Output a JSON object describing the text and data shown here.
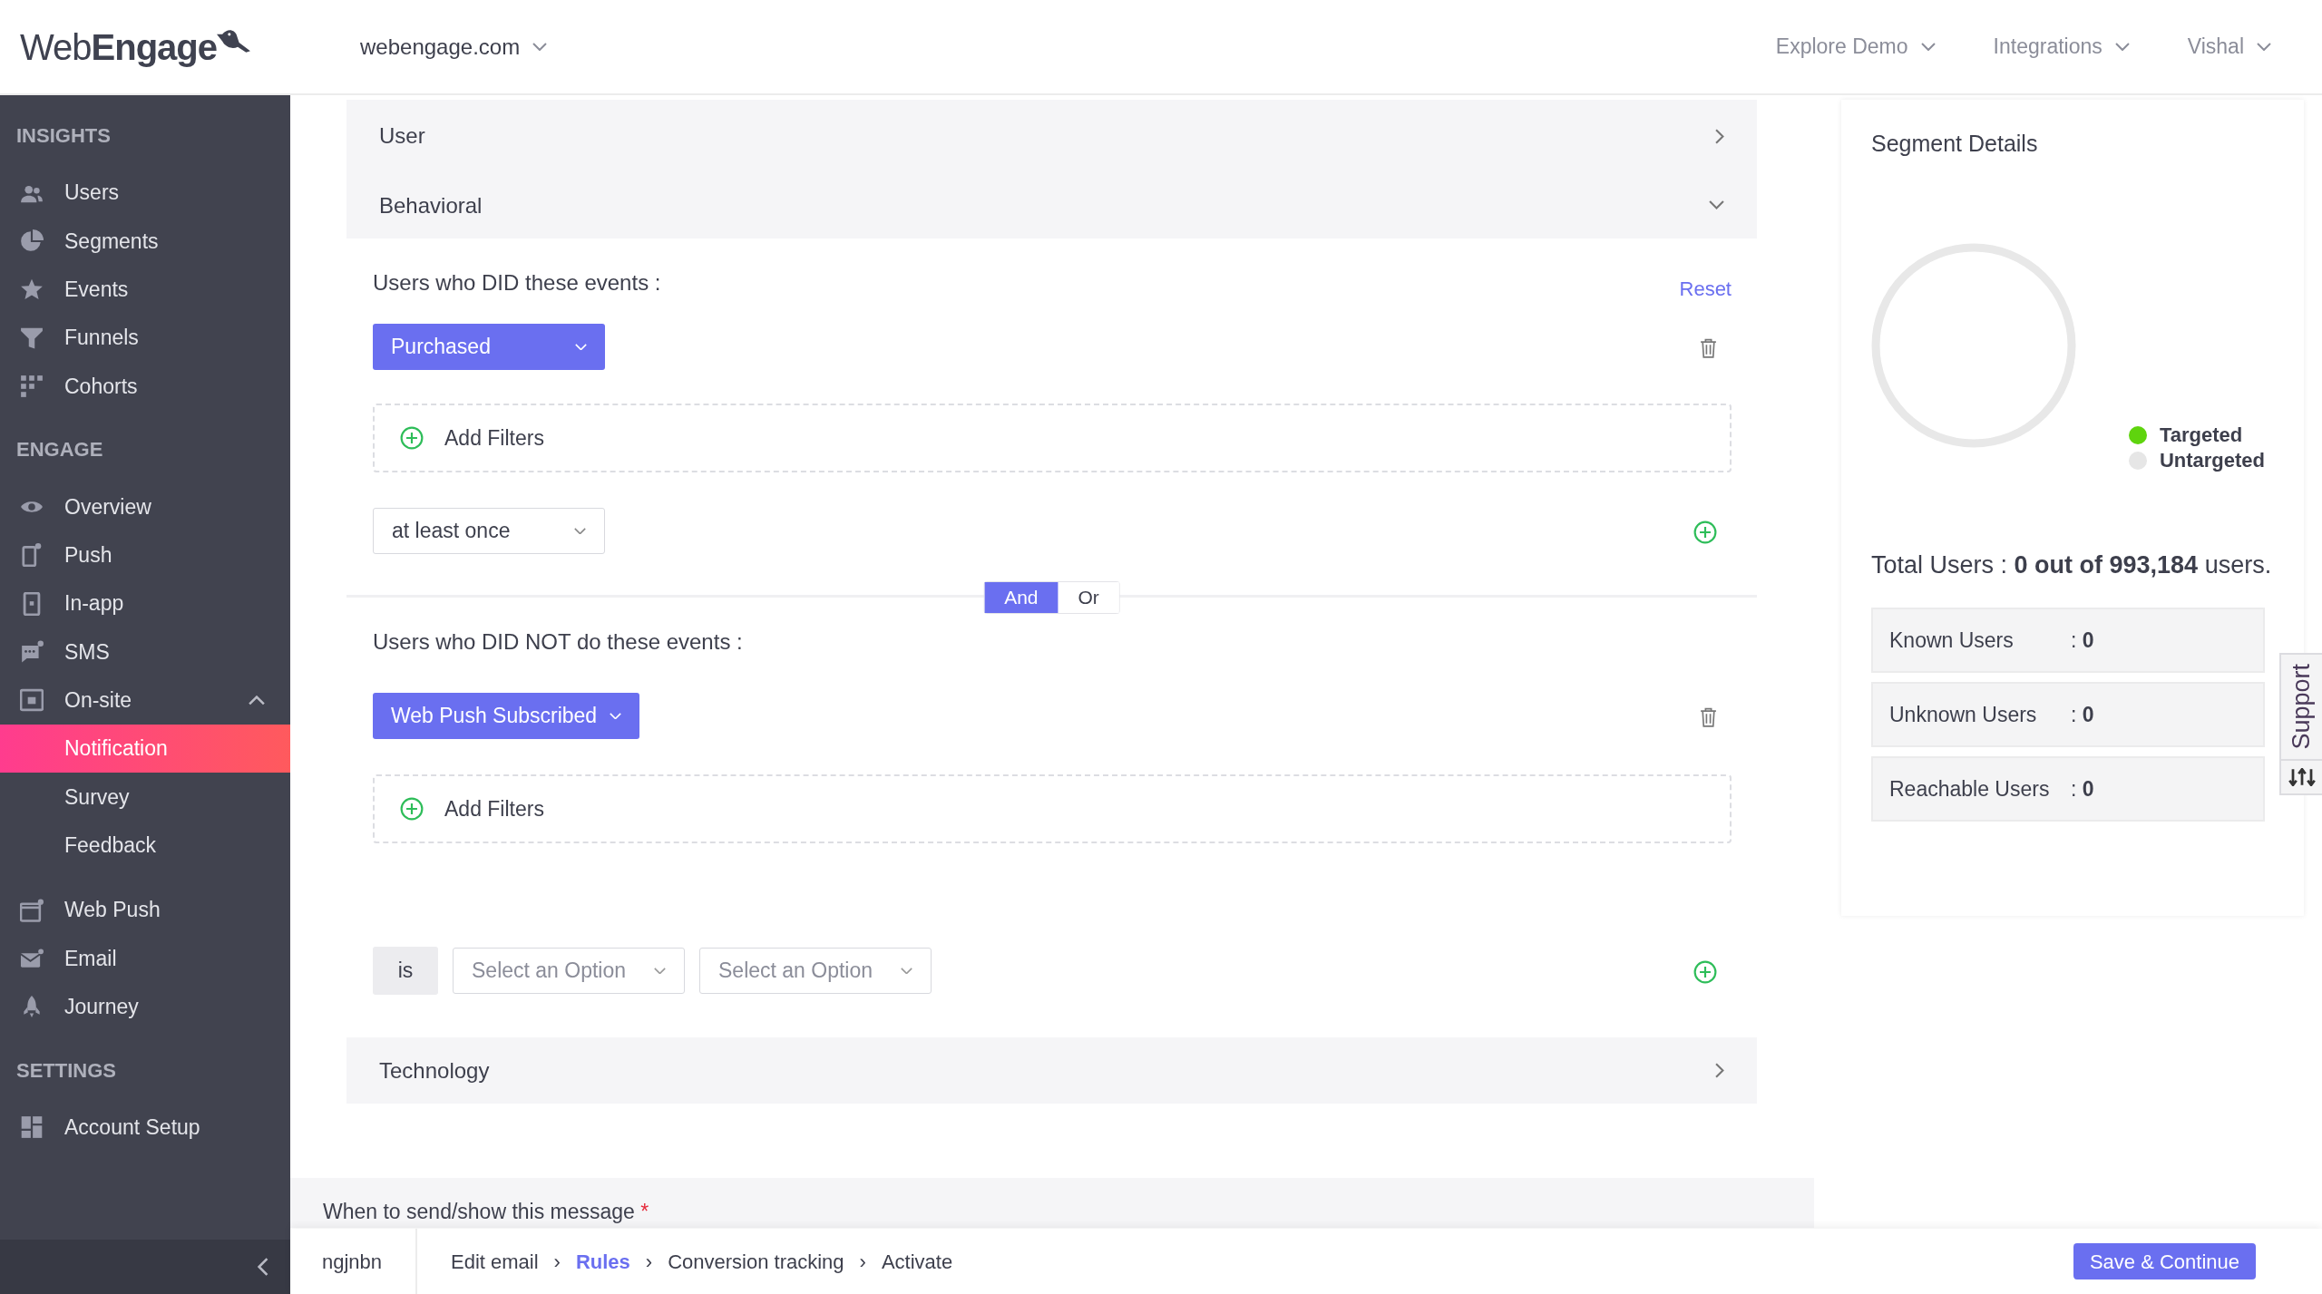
{
  "header": {
    "logo": "Web**Engage**",
    "project": "webengage.com",
    "menus": [
      {
        "label": "Explore Demo"
      },
      {
        "label": "Integrations"
      },
      {
        "label": "Vishal"
      }
    ]
  },
  "sidebar": {
    "sections": [
      {
        "title": "INSIGHTS",
        "items": [
          {
            "label": "Users",
            "selected": false
          },
          {
            "label": "Segments",
            "selected": false
          },
          {
            "label": "Events",
            "selected": false
          },
          {
            "label": "Funnels",
            "selected": false
          },
          {
            "label": "Cohorts",
            "selected": false
          }
        ]
      },
      {
        "title": "ENGAGE",
        "items": [
          {
            "label": "Overview",
            "selected": false
          },
          {
            "label": "Push",
            "selected": false
          },
          {
            "label": "In-app",
            "selected": false
          },
          {
            "label": "SMS",
            "selected": false
          },
          {
            "label": "On-site",
            "selected": false,
            "expanded": true,
            "children": [
              {
                "label": "Notification",
                "selected": true
              },
              {
                "label": "Survey",
                "selected": false
              },
              {
                "label": "Feedback",
                "selected": false
              }
            ]
          },
          {
            "label": "Web Push",
            "selected": false
          },
          {
            "label": "Email",
            "selected": false
          },
          {
            "label": "Journey",
            "selected": false
          }
        ]
      },
      {
        "title": "SETTINGS",
        "items": [
          {
            "label": "Account Setup",
            "selected": false
          }
        ]
      }
    ]
  },
  "segments": [
    {
      "title": "User",
      "expanded": false
    },
    {
      "title": "Behavioral",
      "expanded": true,
      "did": {
        "heading": "Users who DID these events :",
        "reset": "Reset",
        "event": "Purchased",
        "add_filters": "Add Filters",
        "frequency": "at least once"
      },
      "connector": [
        {
          "label": "And",
          "selected": true
        },
        {
          "label": "Or",
          "selected": false
        }
      ],
      "did_not": {
        "heading": "Users who DID NOT do these events :",
        "event": "Web Push Subscribed",
        "add_filters": "Add Filters",
        "operator": "is",
        "selects": [
          {
            "placeholder": "Select an Option"
          },
          {
            "placeholder": "Select an Option"
          }
        ]
      }
    },
    {
      "title": "Technology",
      "expanded": false
    }
  ],
  "when": {
    "label": "When to send/show this message",
    "required_mark": "*"
  },
  "footer": {
    "campaign": "ngjnbn",
    "separator": "›",
    "steps": [
      {
        "label": "Edit email",
        "selected": false
      },
      {
        "label": "Rules",
        "selected": true
      },
      {
        "label": "Conversion tracking",
        "selected": false
      },
      {
        "label": "Activate",
        "selected": false
      }
    ],
    "button": "Save & Continue"
  },
  "segment_details": {
    "title": "Segment Details",
    "legend": [
      {
        "label": "Targeted",
        "color": "#5fd40e"
      },
      {
        "label": "Untargeted",
        "color": "#e6e6e6"
      }
    ],
    "total": "Total Users : **0 out of 993,184** users.",
    "stats": [
      {
        "label": "Known Users",
        "value": ": **0**"
      },
      {
        "label": "Unknown Users",
        "value": ": **0**"
      },
      {
        "label": "Reachable Users",
        "value": ": **0**"
      }
    ]
  },
  "support": {
    "label": "Support"
  }
}
